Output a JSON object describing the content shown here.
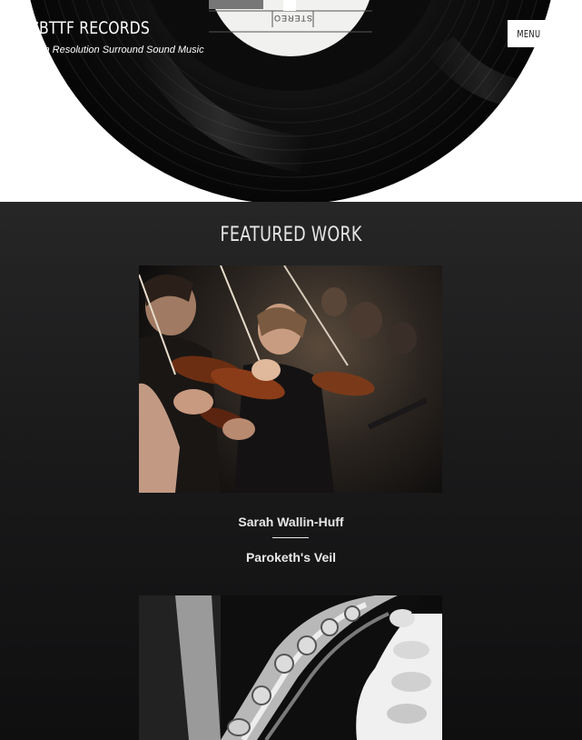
{
  "header": {
    "title": "CBTTF RECORDS",
    "tagline": "High Resolution Surround Sound Music",
    "menu_label": "MENU",
    "record_label_text": "STEREO"
  },
  "featured": {
    "heading": "FEATURED WORK",
    "items": [
      {
        "artist": "Sarah Wallin-Huff",
        "work": "Paroketh's Veil",
        "image": "violin-orchestra-photo"
      },
      {
        "image": "saxophone-photo"
      }
    ]
  },
  "colors": {
    "hero_background": "#ffffff",
    "page_background": "#1b1b1c",
    "text": "#e8e8e8",
    "menu_button": "#ffffff"
  }
}
